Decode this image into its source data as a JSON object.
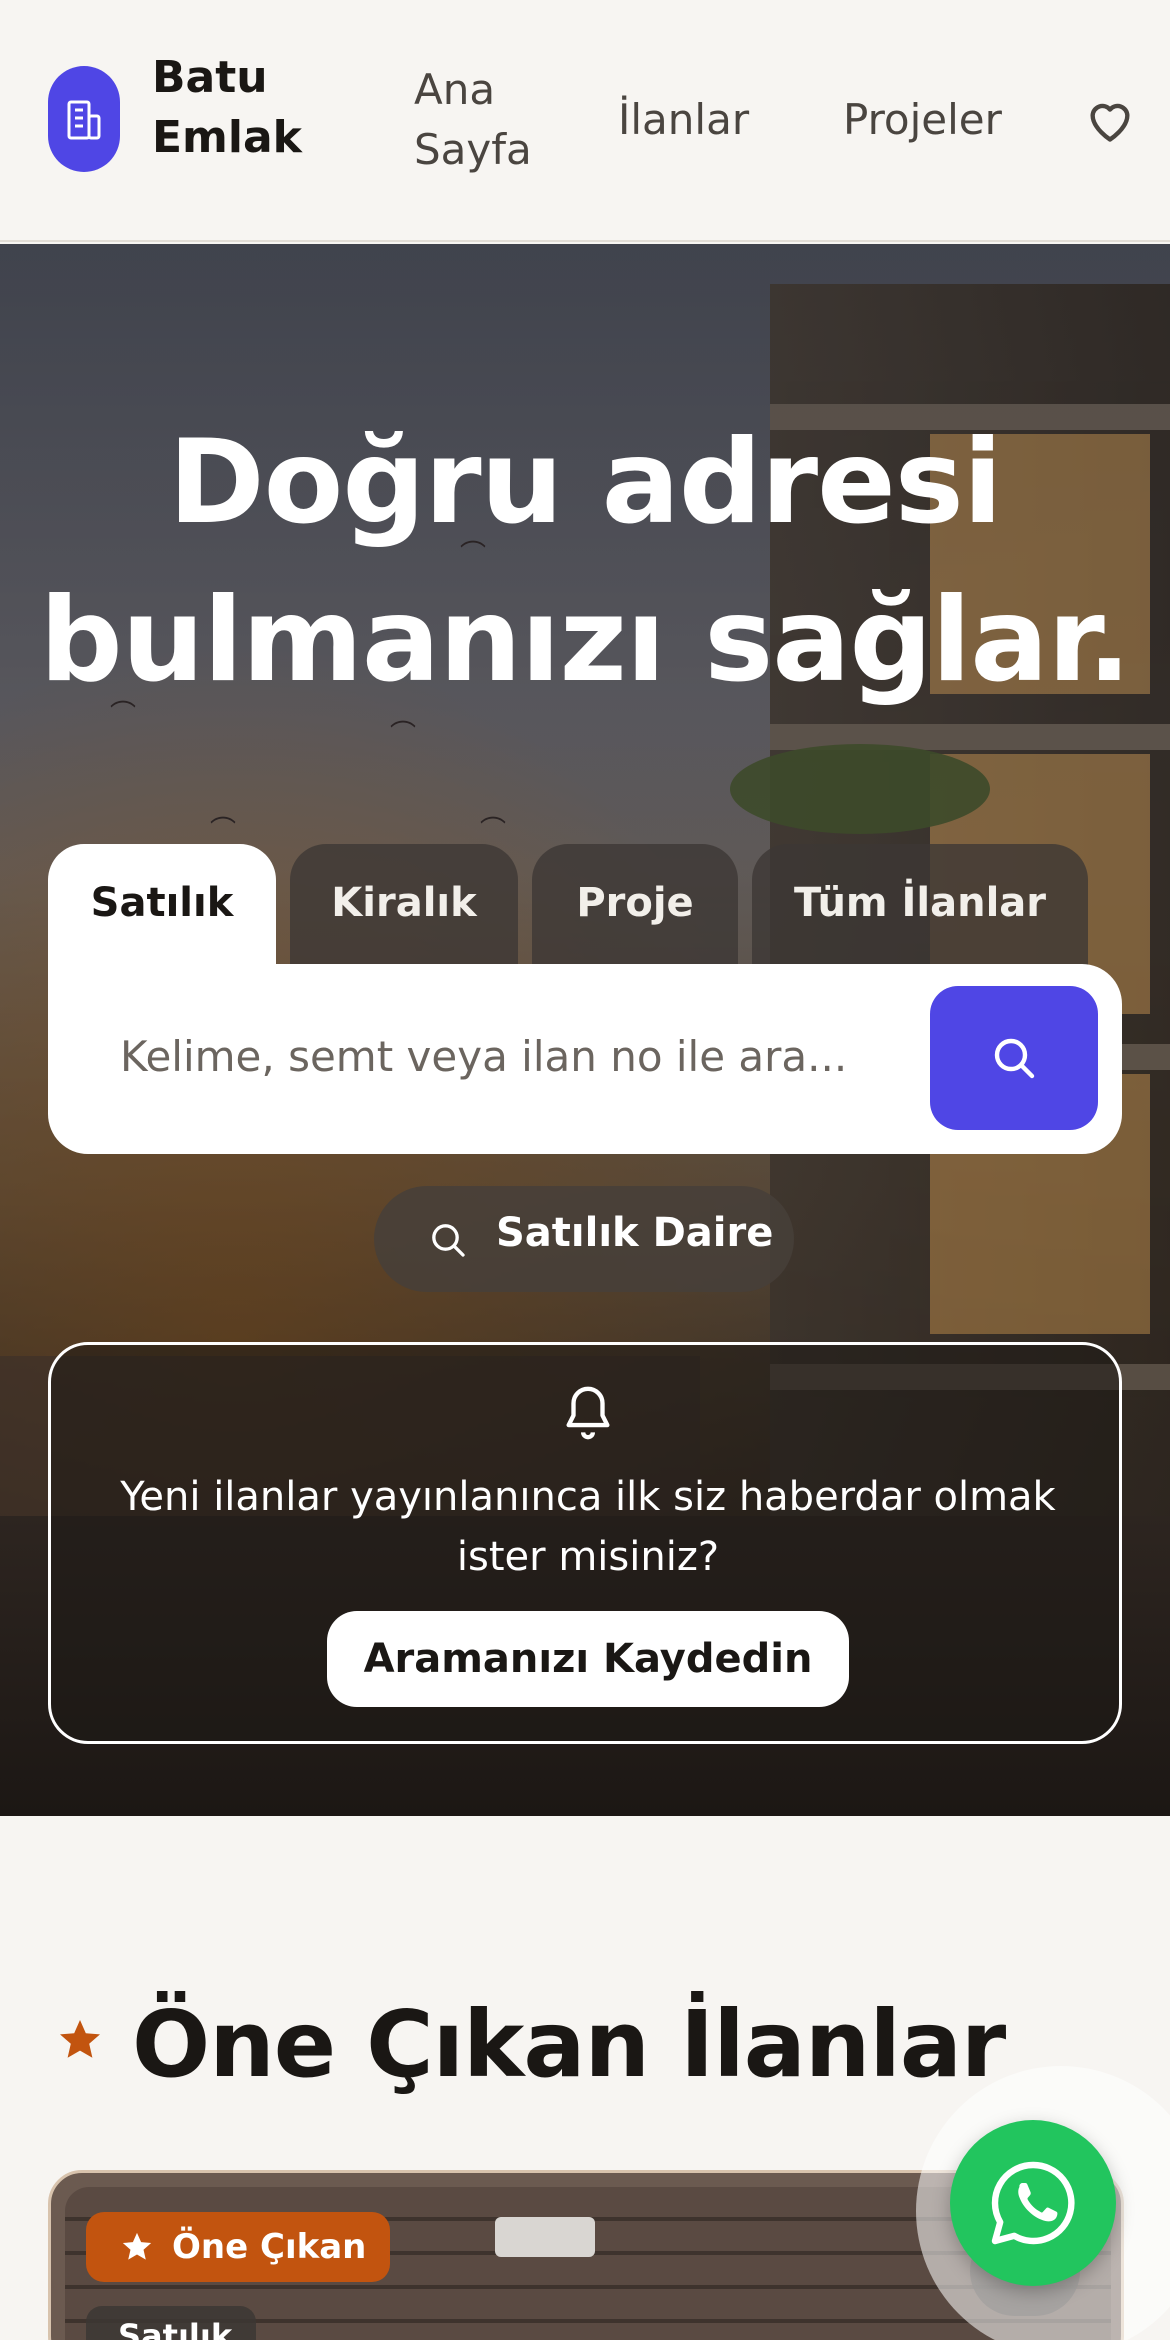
{
  "header": {
    "brand_line1": "Batu",
    "brand_line2": "Emlak",
    "nav": {
      "home": "Ana Sayfa",
      "listings": "İlanlar",
      "projects": "Projeler"
    },
    "icons": {
      "logo": "building-icon",
      "favorites": "heart-icon"
    },
    "accent": "#4f46e5"
  },
  "hero": {
    "title_line1": "Doğru adresi",
    "title_line2": "bulmanızı sağlar.",
    "tabs": [
      {
        "label": "Satılık",
        "active": true
      },
      {
        "label": "Kiralık",
        "active": false
      },
      {
        "label": "Proje",
        "active": false
      },
      {
        "label": "Tüm İlanlar",
        "active": false
      }
    ],
    "search": {
      "placeholder": "Kelime, semt veya ilan no ile ara..."
    },
    "suggestion": "Satılık Daire",
    "alert": {
      "text": "Yeni ilanlar yayınlanınca ilk siz haberdar olmak ister misiniz?",
      "button": "Aramanızı Kaydedin"
    }
  },
  "featured": {
    "title": "Öne Çıkan İlanlar",
    "card": {
      "badge_featured": "Öne Çıkan",
      "badge_type": "Satılık"
    },
    "highlight_color": "#c2540f"
  },
  "whatsapp": {
    "icon": "whatsapp-icon",
    "color": "#22c55e"
  }
}
